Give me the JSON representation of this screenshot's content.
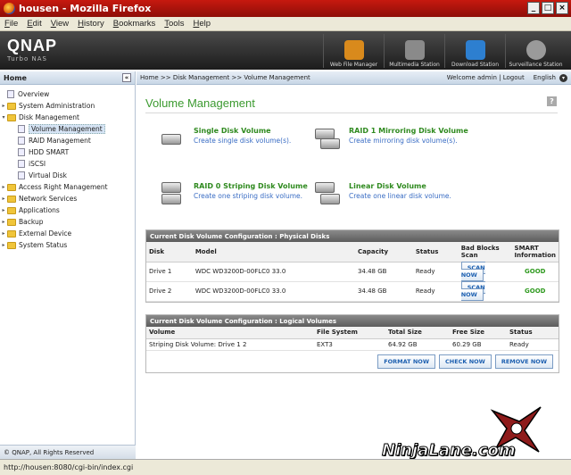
{
  "window": {
    "title": "housen - Mozilla Firefox",
    "buttons": [
      "_",
      "□",
      "×"
    ]
  },
  "menubar": [
    "File",
    "Edit",
    "View",
    "History",
    "Bookmarks",
    "Tools",
    "Help"
  ],
  "header": {
    "logo": "QNAP",
    "sublogo": "Turbo NAS",
    "stations": [
      {
        "label": "Web File Manager",
        "icon": "file-manager-icon",
        "color": "#d98a1c"
      },
      {
        "label": "Multimedia Station",
        "icon": "multimedia-icon",
        "color": "#8a8a8a"
      },
      {
        "label": "Download Station",
        "icon": "download-icon",
        "color": "#2d7fd0"
      },
      {
        "label": "Surveillance Station",
        "icon": "camera-icon",
        "color": "#9a9a9a"
      }
    ]
  },
  "sidebar": {
    "home": "Home",
    "collapse": "«",
    "items": [
      {
        "label": "Overview",
        "type": "doc",
        "level": 0
      },
      {
        "label": "System Administration",
        "type": "folder",
        "level": 0,
        "twisty": "▸"
      },
      {
        "label": "Disk Management",
        "type": "folder",
        "level": 0,
        "twisty": "▾"
      },
      {
        "label": "Volume Management",
        "type": "doc",
        "level": 1,
        "selected": true
      },
      {
        "label": "RAID Management",
        "type": "doc",
        "level": 1
      },
      {
        "label": "HDD SMART",
        "type": "doc",
        "level": 1
      },
      {
        "label": "iSCSI",
        "type": "doc",
        "level": 1
      },
      {
        "label": "Virtual Disk",
        "type": "doc",
        "level": 1
      },
      {
        "label": "Access Right Management",
        "type": "folder",
        "level": 0,
        "twisty": "▸"
      },
      {
        "label": "Network Services",
        "type": "folder",
        "level": 0,
        "twisty": "▸"
      },
      {
        "label": "Applications",
        "type": "folder",
        "level": 0,
        "twisty": "▸"
      },
      {
        "label": "Backup",
        "type": "folder",
        "level": 0,
        "twisty": "▸"
      },
      {
        "label": "External Device",
        "type": "folder",
        "level": 0,
        "twisty": "▸"
      },
      {
        "label": "System Status",
        "type": "folder",
        "level": 0,
        "twisty": "▸"
      }
    ],
    "footer": "© QNAP, All Rights Reserved"
  },
  "topbar": {
    "breadcrumb": "Home >> Disk Management >> Volume Management",
    "welcome": "Welcome admin | Logout",
    "language": "English"
  },
  "content": {
    "title": "Volume Management",
    "help": "?",
    "volume_types": [
      {
        "title": "Single Disk Volume",
        "desc": "Create single disk volume(s)."
      },
      {
        "title": "RAID 1 Mirroring Disk Volume",
        "desc": "Create mirroring disk volume(s)."
      },
      {
        "title": "RAID 0 Striping Disk Volume",
        "desc": "Create one striping disk volume."
      },
      {
        "title": "Linear Disk Volume",
        "desc": "Create one linear disk volume."
      }
    ],
    "physical": {
      "heading": "Current Disk Volume Configuration : Physical Disks",
      "columns": [
        "Disk",
        "Model",
        "Capacity",
        "Status",
        "Bad Blocks Scan",
        "SMART Information"
      ],
      "rows": [
        {
          "disk": "Drive 1",
          "model": "WDC WD3200D-00FLC0 33.0",
          "capacity": "34.48 GB",
          "status": "Ready",
          "scan": "SCAN NOW",
          "smart": "GOOD"
        },
        {
          "disk": "Drive 2",
          "model": "WDC WD3200D-00FLC0 33.0",
          "capacity": "34.48 GB",
          "status": "Ready",
          "scan": "SCAN NOW",
          "smart": "GOOD"
        }
      ]
    },
    "logical": {
      "heading": "Current Disk Volume Configuration : Logical Volumes",
      "columns": [
        "Volume",
        "File System",
        "Total Size",
        "Free Size",
        "Status"
      ],
      "rows": [
        {
          "volume": "Striping Disk Volume: Drive 1 2",
          "fs": "EXT3",
          "total": "64.92 GB",
          "free": "60.29 GB",
          "status": "Ready"
        }
      ],
      "actions": [
        "FORMAT NOW",
        "CHECK NOW",
        "REMOVE NOW"
      ]
    }
  },
  "statusbar": {
    "url": "http://housen:8080/cgi-bin/index.cgi"
  },
  "watermark": "NinjaLane.com",
  "colors": {
    "accent_green": "#3b9a2f",
    "link_blue": "#3a6dc4",
    "title_red": "#c6190f"
  }
}
